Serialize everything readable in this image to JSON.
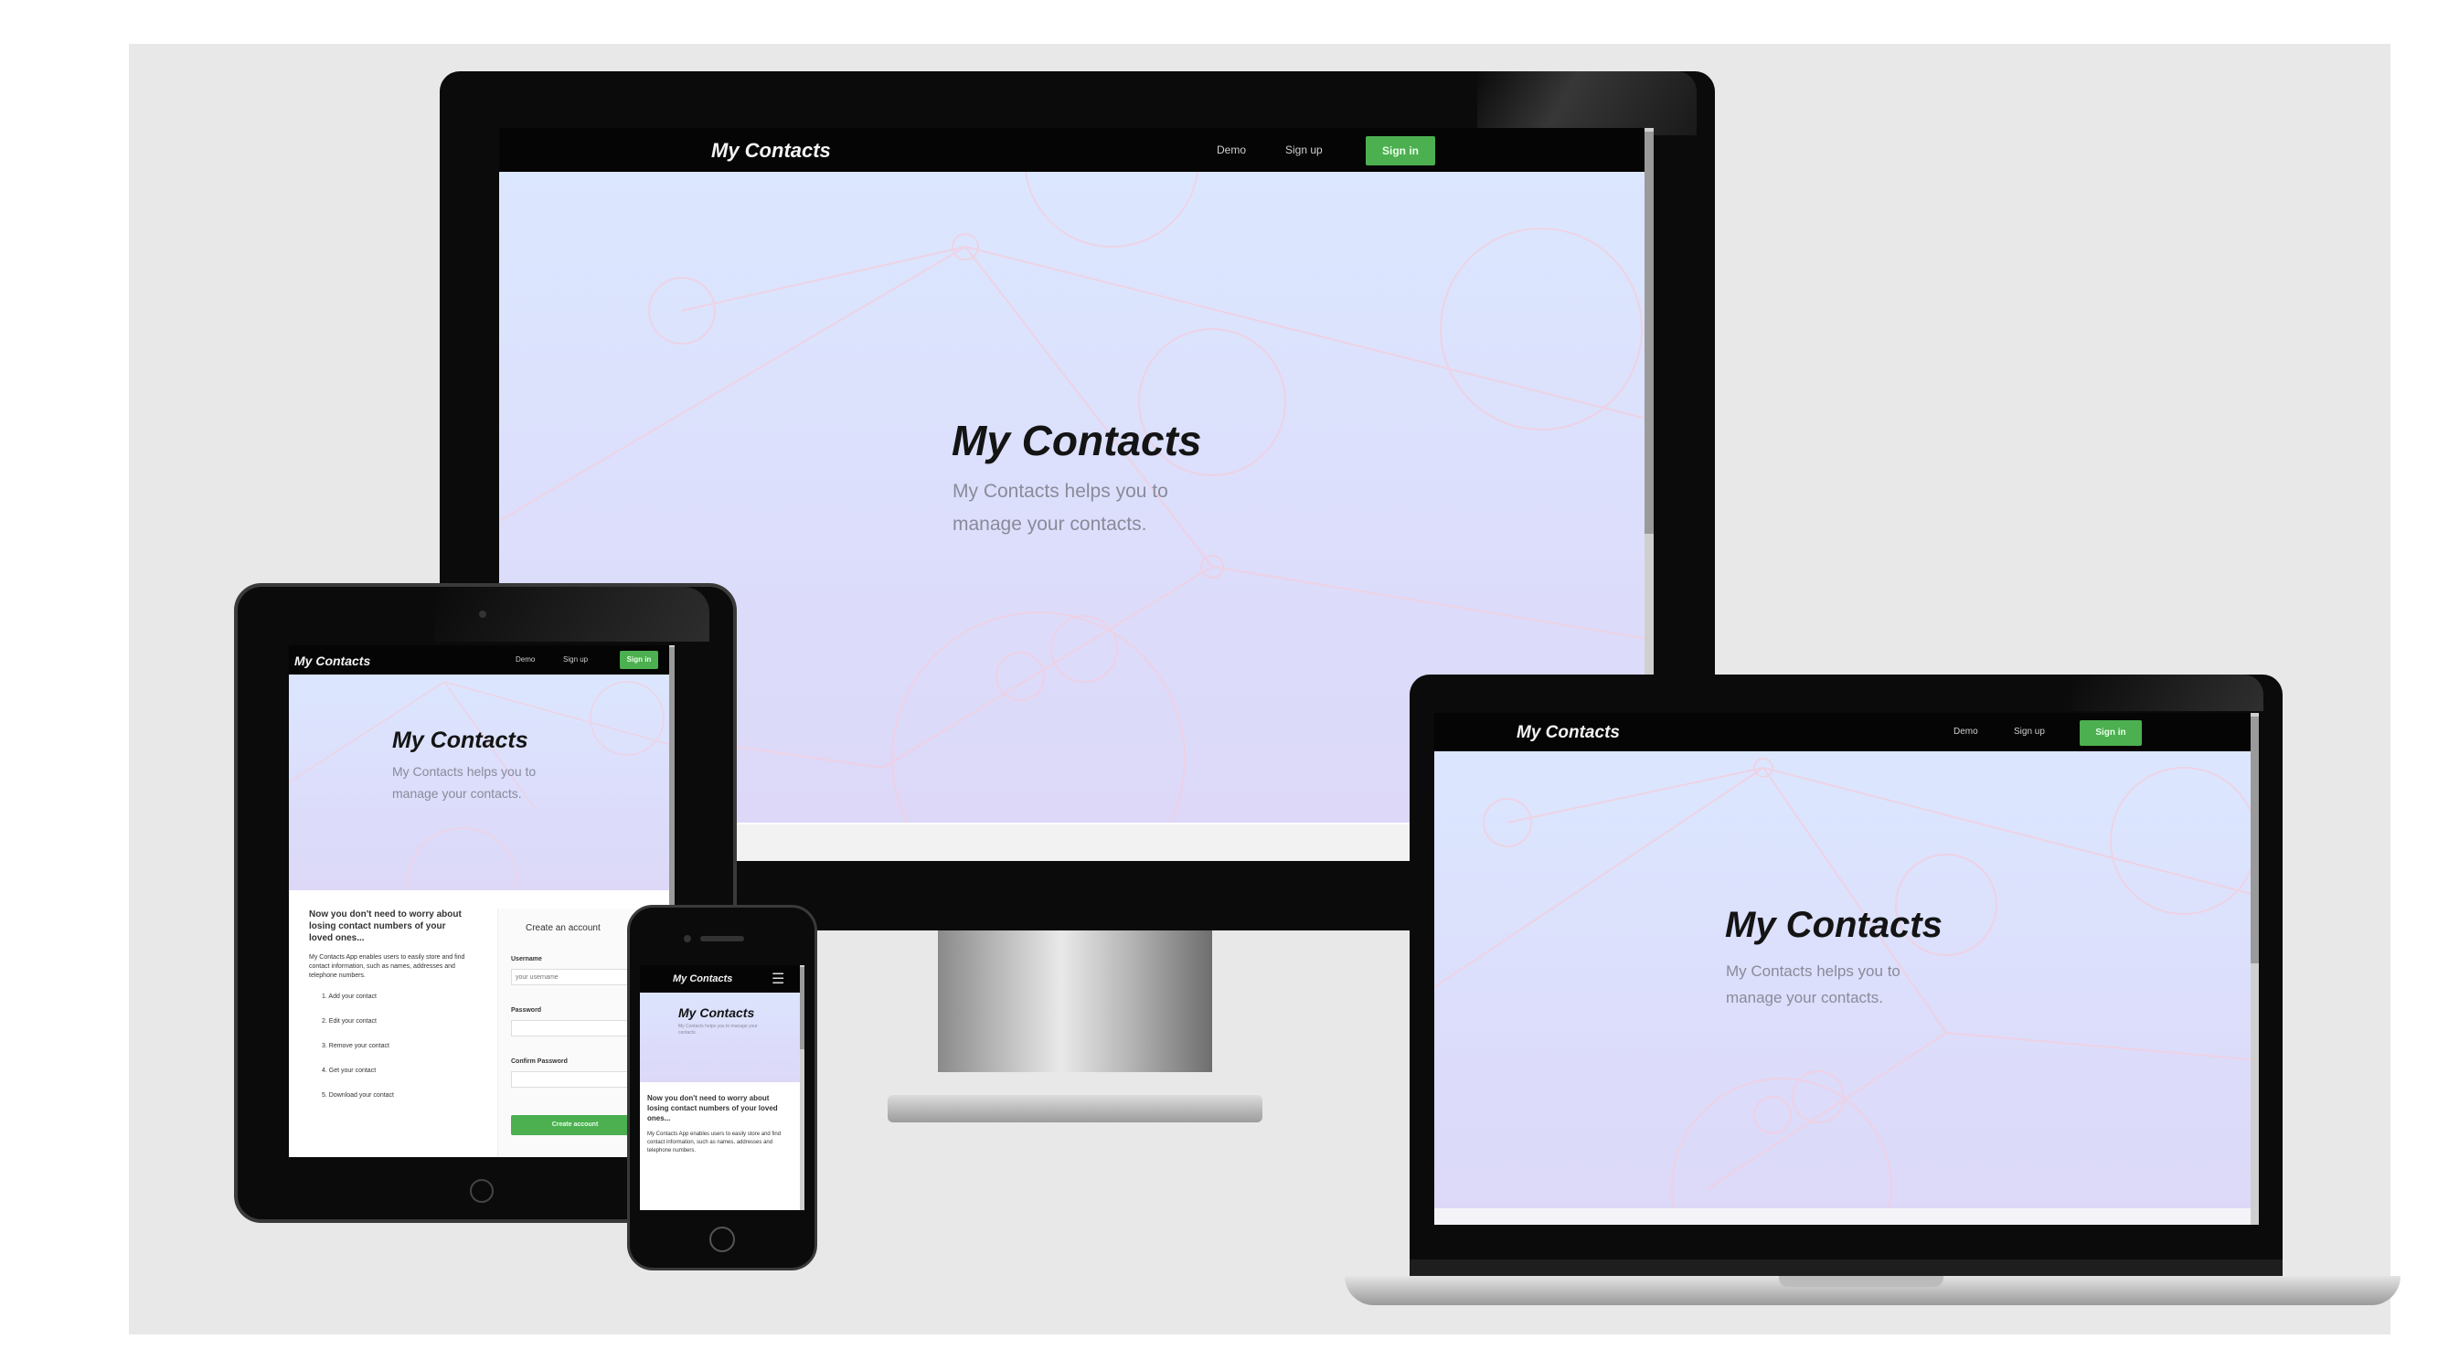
{
  "app": {
    "brand": "My Contacts",
    "hero_title": "My Contacts",
    "hero_subtitle": "My Contacts helps you to manage your contacts."
  },
  "nav": {
    "demo_label": "Demo",
    "signup_label": "Sign up",
    "signin_label": "Sign in",
    "menu_icon": "hamburger-menu-icon"
  },
  "section": {
    "heading": "Now you don't need to worry about losing contact numbers of your loved ones...",
    "description": "My Contacts App enables users to easily store and find contact information, such as names, addresses and telephone numbers.",
    "features": [
      "1. Add your contact",
      "2. Edit your contact",
      "3. Remove your contact",
      "4. Get your contact",
      "5. Download your contact"
    ]
  },
  "signup_form": {
    "title": "Create an account",
    "username_label": "Username",
    "username_placeholder": "your username",
    "password_label": "Password",
    "confirm_label": "Confirm Password",
    "submit_label": "Create account"
  },
  "colors": {
    "accent_green": "#4caf50",
    "navbar": "#050505",
    "backdrop": "#e8e8e8"
  }
}
